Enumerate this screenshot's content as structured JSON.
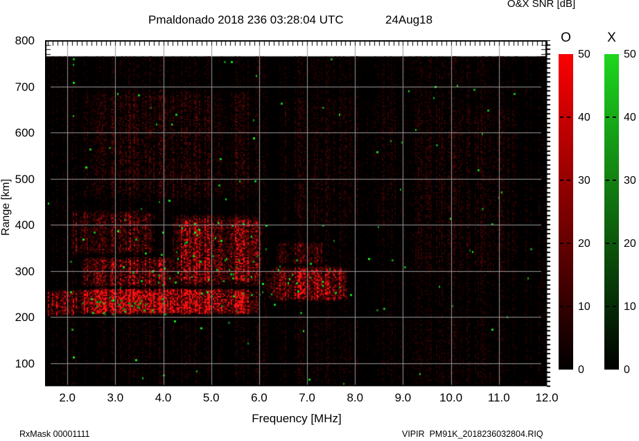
{
  "chart_data": {
    "type": "heatmap",
    "title": "Pmaldonado 2018 236 03:28:04 UTC",
    "subtitle_date": "24Aug18",
    "xlabel": "Frequency [MHz]",
    "ylabel": "Range [km]",
    "colorbar_title": "O&X SNR [dB]",
    "xlim_mhz": [
      1.535,
      12.0
    ],
    "ylim_km": [
      50,
      800
    ],
    "data_extent_km": [
      50,
      765
    ],
    "grid": true,
    "xtick_values": [
      2,
      3,
      4,
      5,
      6,
      7,
      8,
      9,
      10,
      11,
      12
    ],
    "xtick_labels": [
      "2.0",
      "3.0",
      "4.0",
      "5.0",
      "6.0",
      "7.0",
      "8.0",
      "9.0",
      "10.0",
      "11.0",
      "12.0"
    ],
    "ytick_values": [
      800,
      700,
      600,
      500,
      400,
      300,
      200,
      100
    ],
    "ytick_labels": [
      "800",
      "700",
      "600",
      "500",
      "400",
      "300",
      "200",
      "100"
    ],
    "legend": {
      "o_label": "O",
      "x_label": "X",
      "snr_min": 0,
      "snr_max": 50,
      "snr_ticks": [
        "50",
        "40",
        "30",
        "20",
        "10",
        "0"
      ],
      "snr_dash_values": [
        40,
        30,
        20,
        10
      ],
      "o_color_top": "#fb0000",
      "x_color_top": "#1ed61e",
      "color_bottom": "#000000"
    },
    "echo_regions": [
      {
        "f": [
          1.535,
          2.2
        ],
        "r": [
          200,
          260
        ],
        "intensity": 0.45
      },
      {
        "f": [
          2.05,
          6.05
        ],
        "r": [
          204,
          263
        ],
        "intensity": 0.95
      },
      {
        "f": [
          2.2,
          4.3
        ],
        "r": [
          263,
          332
        ],
        "intensity": 0.4
      },
      {
        "f": [
          4.15,
          6.1
        ],
        "r": [
          263,
          425
        ],
        "intensity": 0.55
      },
      {
        "f": [
          2.0,
          3.9
        ],
        "r": [
          332,
          435
        ],
        "intensity": 0.26
      },
      {
        "f": [
          6.1,
          7.9
        ],
        "r": [
          232,
          312
        ],
        "intensity": 0.5
      },
      {
        "f": [
          6.3,
          7.4
        ],
        "r": [
          312,
          365
        ],
        "intensity": 0.22
      },
      {
        "f": [
          2.0,
          6.2
        ],
        "r": [
          435,
          710
        ],
        "intensity": 0.13
      },
      {
        "f": [
          6.2,
          9.2
        ],
        "r": [
          365,
          710
        ],
        "intensity": 0.08
      },
      {
        "f": [
          9.0,
          11.6
        ],
        "r": [
          250,
          700
        ],
        "intensity": 0.08
      },
      {
        "f": [
          1.535,
          12.0
        ],
        "r": [
          50,
          204
        ],
        "intensity": 0.06
      },
      {
        "f": [
          7.9,
          12.0
        ],
        "r": [
          204,
          765
        ],
        "intensity": 0.055
      },
      {
        "f": [
          1.535,
          12.0
        ],
        "r": [
          710,
          765
        ],
        "intensity": 0.06
      }
    ],
    "green_specks": [
      {
        "f": [
          2.5,
          4.05
        ],
        "r": [
          206,
          240
        ],
        "p": 0.04
      },
      {
        "f": [
          3.9,
          6.1
        ],
        "r": [
          240,
          405
        ],
        "p": 0.012
      },
      {
        "f": [
          6.25,
          7.7
        ],
        "r": [
          245,
          320
        ],
        "p": 0.012
      },
      {
        "f": [
          1.535,
          12.0
        ],
        "r": [
          55,
          760
        ],
        "p": 0.0012
      }
    ],
    "noise_floor": 0.05,
    "seed": 1337
  },
  "footer": {
    "left": "RxMask 00001111",
    "right": "VIPIR  PM91K_2018236032804.RIQ"
  }
}
